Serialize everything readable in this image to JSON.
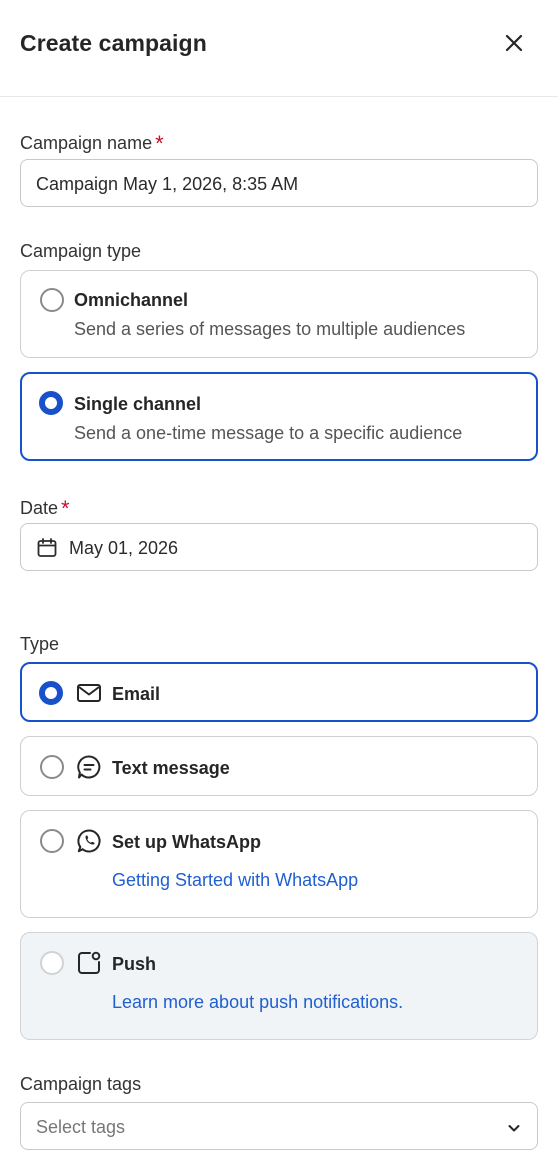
{
  "header": {
    "title": "Create campaign",
    "close_icon": "close-icon"
  },
  "campaign_name": {
    "label": "Campaign name",
    "required": "*",
    "value": "Campaign May 1, 2026, 8:35 AM"
  },
  "campaign_type": {
    "label": "Campaign type",
    "options": [
      {
        "title": "Omnichannel",
        "description": "Send a series of messages to multiple audiences",
        "selected": false
      },
      {
        "title": "Single channel",
        "description": "Send a one-time message to a specific audience",
        "selected": true
      }
    ]
  },
  "date": {
    "label": "Date",
    "required": "*",
    "value": "May 01, 2026",
    "icon": "calendar-icon"
  },
  "type": {
    "label": "Type",
    "options": [
      {
        "title": "Email",
        "icon": "envelope-icon",
        "selected": true
      },
      {
        "title": "Text message",
        "icon": "chat-bubble-icon",
        "selected": false
      },
      {
        "title": "Set up WhatsApp",
        "icon": "whatsapp-icon",
        "link": "Getting Started with WhatsApp",
        "selected": false
      },
      {
        "title": "Push",
        "icon": "push-notification-icon",
        "link": "Learn more about push notifications.",
        "selected": false,
        "disabled": true
      }
    ]
  },
  "campaign_tags": {
    "label": "Campaign tags",
    "placeholder": "Select tags",
    "icon": "chevron-down-icon"
  },
  "colors": {
    "accent": "#1851c9",
    "link": "#1f5fd1",
    "required": "#c8102e",
    "disabled_bg": "#f1f4f6"
  }
}
